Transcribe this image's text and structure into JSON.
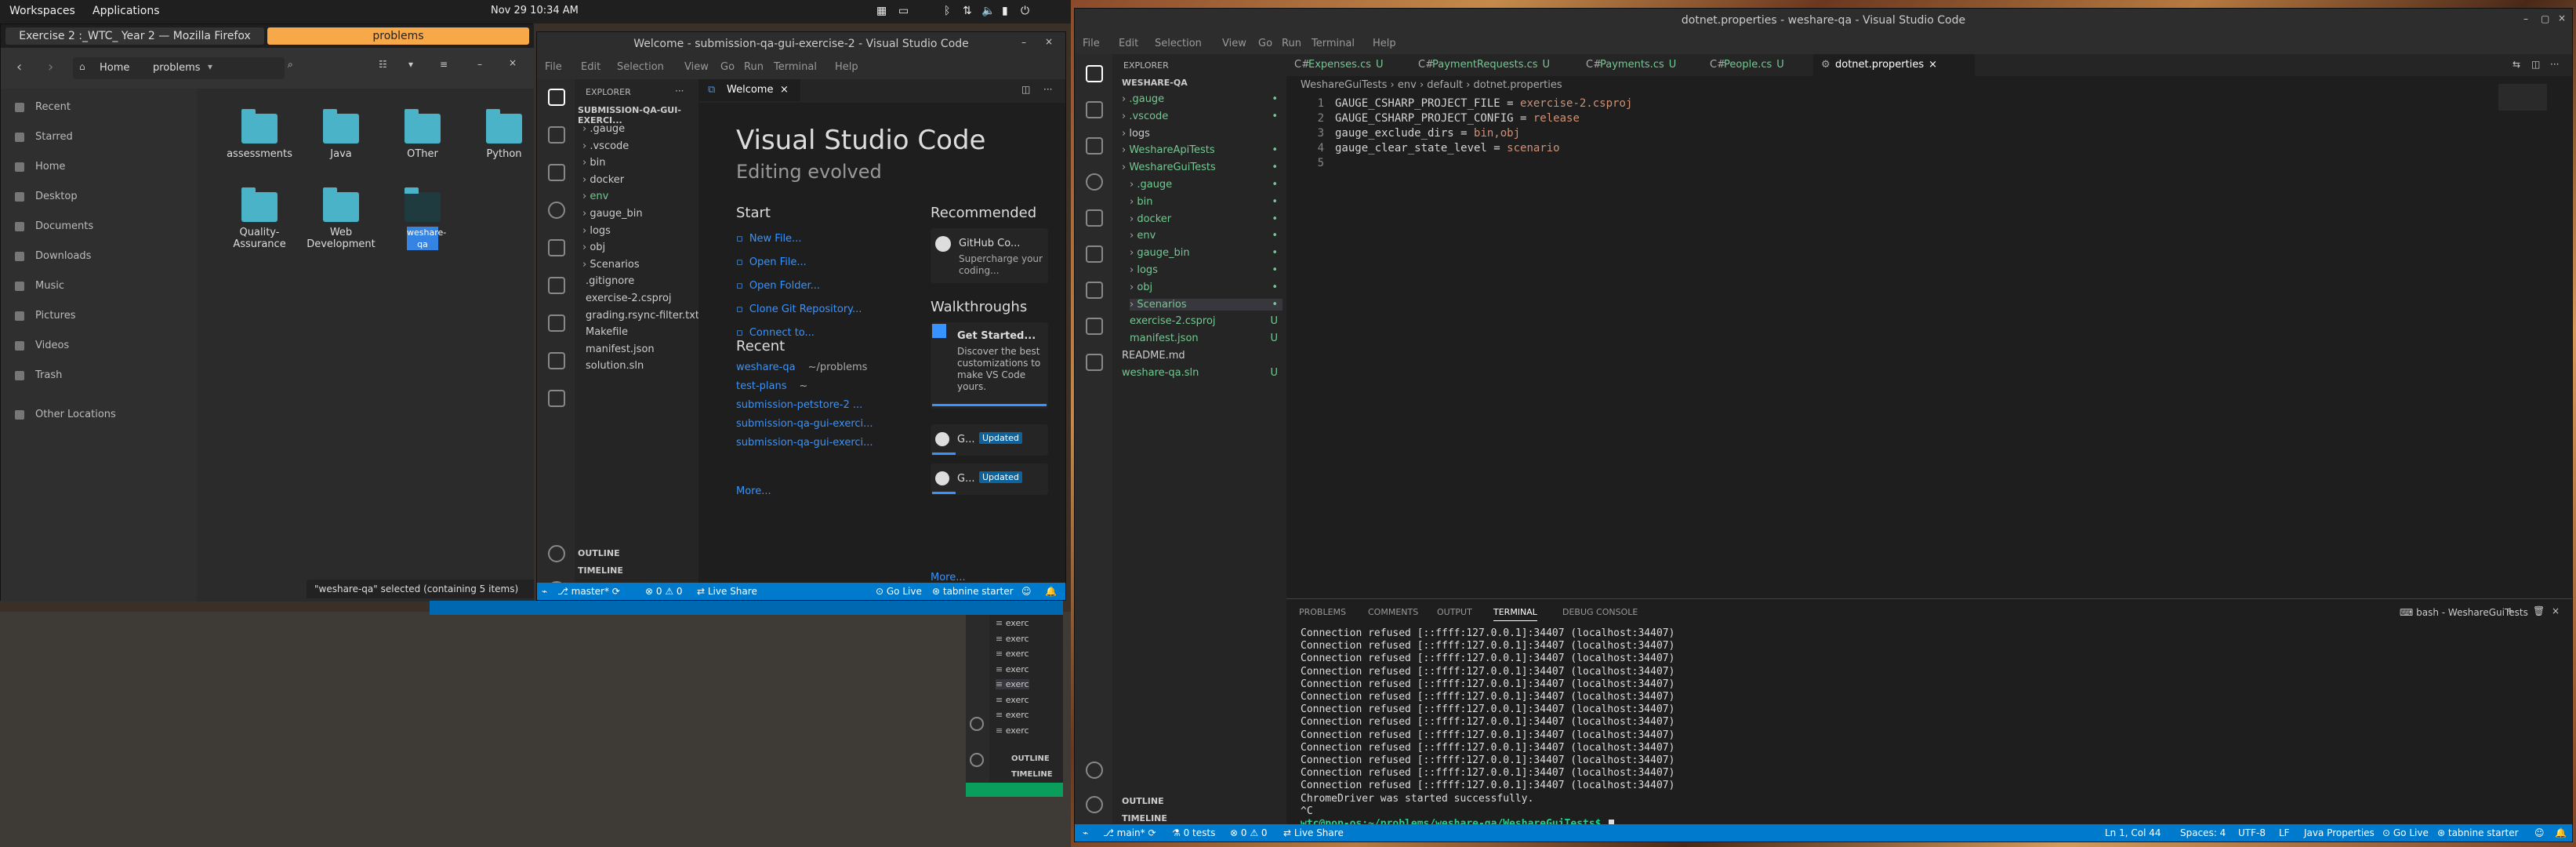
{
  "desktop": {
    "workspaces_label": "Workspaces",
    "applications_label": "Applications",
    "clock": "Nov 29  10:34 AM",
    "firefox_tab": "Exercise 2 :_WTC_ Year 2 — Mozilla Firefox",
    "files_tab": "problems"
  },
  "files": {
    "home_label": "Home",
    "path_label": "problems",
    "sidebar": [
      "Recent",
      "Starred",
      "Home",
      "Desktop",
      "Documents",
      "Downloads",
      "Music",
      "Pictures",
      "Videos",
      "Trash",
      "Other Locations"
    ],
    "folders": [
      {
        "name": "assessments"
      },
      {
        "name": "Java"
      },
      {
        "name": "OTher"
      },
      {
        "name": "Python"
      },
      {
        "name": "Quality-Assurance"
      },
      {
        "name": "Web Development"
      },
      {
        "name": "weshare-qa"
      }
    ],
    "status_text": "\"weshare-qa\" selected (containing 5 items)"
  },
  "vscode_left": {
    "title": "Welcome - submission-qa-gui-exercise-2 - Visual Studio Code",
    "menu": [
      "File",
      "Edit",
      "Selection",
      "View",
      "Go",
      "Run",
      "Terminal",
      "Help"
    ],
    "explorer_label": "EXPLORER",
    "project_label": "SUBMISSION-QA-GUI-EXERCI...",
    "tree": [
      ".gauge",
      ".vscode",
      "bin",
      "docker",
      "env",
      "gauge_bin",
      "logs",
      "obj",
      "Scenarios",
      ".gitignore",
      "exercise-2.csproj",
      "grading.rsync-filter.txt",
      "Makefile",
      "manifest.json",
      "solution.sln"
    ],
    "outline_label": "OUTLINE",
    "timeline_label": "TIMELINE",
    "tab_label": "Welcome",
    "heading": "Visual Studio Code",
    "subheading": "Editing evolved",
    "start_label": "Start",
    "start_links": [
      "New File...",
      "Open File...",
      "Open Folder...",
      "Clone Git Repository...",
      "Connect to..."
    ],
    "recent_label": "Recent",
    "recent": [
      {
        "name": "weshare-qa",
        "path": "~/problems"
      },
      {
        "name": "test-plans",
        "path": "~"
      },
      {
        "name": "submission-petstore-2 ...",
        "path": ""
      },
      {
        "name": "submission-qa-gui-exerci...",
        "path": ""
      },
      {
        "name": "submission-qa-gui-exerci...",
        "path": ""
      }
    ],
    "more_label": "More...",
    "recommended_label": "Recommended",
    "recommended_title": "GitHub Co...",
    "recommended_desc": "Supercharge your coding...",
    "walkthroughs_label": "Walkthroughs",
    "walk_title": "Get Started...",
    "walk_desc": "Discover the best customizations to make VS Code yours.",
    "walk_items": [
      {
        "title": "G...",
        "badge": "Updated"
      },
      {
        "title": "G...",
        "badge": "Updated"
      }
    ],
    "walk_more": "More...",
    "status": {
      "branch": "master*",
      "errors": "0 ⚠ 0",
      "liveshare": "Live Share",
      "golive": "Go Live",
      "tabnine": "tabnine starter"
    }
  },
  "vscode_right": {
    "title": "dotnet.properties - weshare-qa - Visual Studio Code",
    "menu": [
      "File",
      "Edit",
      "Selection",
      "View",
      "Go",
      "Run",
      "Terminal",
      "Help"
    ],
    "explorer_label": "EXPLORER",
    "project_label": "WESHARE-QA",
    "tree": [
      {
        "label": ".gauge",
        "mark": "•"
      },
      {
        "label": ".vscode",
        "mark": "•"
      },
      {
        "label": "logs",
        "mark": ""
      },
      {
        "label": "WeshareApiTests",
        "mark": "•"
      },
      {
        "label": "WeshareGuiTests",
        "mark": "•"
      },
      {
        "label": ".gauge",
        "mark": "•"
      },
      {
        "label": "bin",
        "mark": "•"
      },
      {
        "label": "docker",
        "mark": "•"
      },
      {
        "label": "env",
        "mark": "•"
      },
      {
        "label": "gauge_bin",
        "mark": "•"
      },
      {
        "label": "logs",
        "mark": "•"
      },
      {
        "label": "obj",
        "mark": "•"
      },
      {
        "label": "Scenarios",
        "mark": "•"
      },
      {
        "label": "exercise-2.csproj",
        "mark": "U"
      },
      {
        "label": "manifest.json",
        "mark": "U"
      },
      {
        "label": "README.md",
        "mark": ""
      },
      {
        "label": "weshare-qa.sln",
        "mark": "U"
      }
    ],
    "outline_label": "OUTLINE",
    "timeline_label": "TIMELINE",
    "tabs": [
      {
        "label": "Expenses.cs",
        "mark": "U"
      },
      {
        "label": "PaymentRequests.cs",
        "mark": "U"
      },
      {
        "label": "Payments.cs",
        "mark": "U"
      },
      {
        "label": "People.cs",
        "mark": "U"
      },
      {
        "label": "dotnet.properties",
        "mark": "×"
      }
    ],
    "breadcrumb": "WeshareGuiTests  ›  env  ›  default  ›  dotnet.properties",
    "code": [
      {
        "n": "1",
        "key": "GAUGE_CSHARP_PROJECT_FILE",
        "val": "exercise-2.csproj"
      },
      {
        "n": "2",
        "key": "GAUGE_CSHARP_PROJECT_CONFIG",
        "val": "release"
      },
      {
        "n": "3",
        "key": "gauge_exclude_dirs",
        "val": "bin,obj"
      },
      {
        "n": "4",
        "key": "gauge_clear_state_level",
        "val": "scenario"
      },
      {
        "n": "5",
        "key": "",
        "val": ""
      }
    ],
    "panel_tabs": [
      "PROBLEMS",
      "COMMENTS",
      "OUTPUT",
      "TERMINAL",
      "DEBUG CONSOLE"
    ],
    "terminal_label": "bash - WeshareGuiTests",
    "terminal_lines": [
      "Connection refused [::ffff:127.0.0.1]:34407 (localhost:34407)",
      "Connection refused [::ffff:127.0.0.1]:34407 (localhost:34407)",
      "Connection refused [::ffff:127.0.0.1]:34407 (localhost:34407)",
      "Connection refused [::ffff:127.0.0.1]:34407 (localhost:34407)",
      "Connection refused [::ffff:127.0.0.1]:34407 (localhost:34407)",
      "Connection refused [::ffff:127.0.0.1]:34407 (localhost:34407)",
      "Connection refused [::ffff:127.0.0.1]:34407 (localhost:34407)",
      "Connection refused [::ffff:127.0.0.1]:34407 (localhost:34407)",
      "Connection refused [::ffff:127.0.0.1]:34407 (localhost:34407)",
      "Connection refused [::ffff:127.0.0.1]:34407 (localhost:34407)",
      "Connection refused [::ffff:127.0.0.1]:34407 (localhost:34407)",
      "Connection refused [::ffff:127.0.0.1]:34407 (localhost:34407)",
      "Connection refused [::ffff:127.0.0.1]:34407 (localhost:34407)",
      "ChromeDriver was started successfully.",
      "^C"
    ],
    "prompt": "wtc@pop-os:~/problems/weshare-qa/WeshareGuiTests$",
    "status": {
      "branch": "main*",
      "tests": "0 tests",
      "errors": "0 ⚠ 0",
      "liveshare": "Live Share",
      "position": "Ln 1, Col 44",
      "spaces": "Spaces: 4",
      "encoding": "UTF-8",
      "eol": "LF",
      "lang": "Java Properties",
      "golive": "Go Live",
      "tabnine": "tabnine starter"
    }
  },
  "vscode_back": {
    "outline_label": "OUTLINE",
    "timeline_label": "TIMELINE",
    "items": [
      "exerc",
      "exerc",
      "exerc",
      "exerc",
      "exerc",
      "exerc",
      "exerc",
      "exerc"
    ]
  },
  "colors": {
    "accent": "#007acc",
    "folder": "#4bb3c8",
    "selected_tab": "#f7a94a",
    "git_modified": "#73c991"
  }
}
